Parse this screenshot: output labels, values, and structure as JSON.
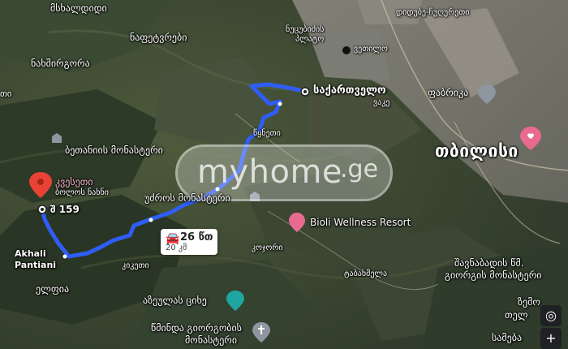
{
  "labels": {
    "mskhaldidi": "მსხალდიდი",
    "naftebi": "ნაფეტვრები",
    "nabshi": "ნახშირგორა",
    "ti": "თი",
    "betania": "ბეთანიის მონასტერი",
    "saqartvelo": "საქართველო",
    "vake": "ვაკე",
    "fabrika": "ფაბრიკა",
    "tbilisi": "თბილისი",
    "tskneti": "წყნეთი",
    "kvesety_line1": "კვესეთი",
    "kvesety_line2": "ბოლოს ნახნი",
    "sh159": "შ 159",
    "udzros": "უძროს მონასტერი",
    "bioli": "Bioli Wellness Resort",
    "akhali1": "Akhali",
    "akhali2": "Pantiani",
    "kojori": "კოჯორი",
    "kiketi": "კიკეთი",
    "tabakhmela": "ტაბახმელა",
    "elfia": "ელფია",
    "azeulas": "აზეულას ციხე",
    "tsminda1": "წმინდა გიორგობის",
    "tsminda2": "მონასტერი",
    "shavnabada1": "შავნაბადის წმ.",
    "shavnabada2": "გიორგის მონასტერი",
    "samgeba": "სამება",
    "digomi": "დიდუბე-ჩუღურეთი",
    "nutsubidze1": "ნუცუბიძის",
    "nutsubidze2": "პლატო",
    "ukhili": "ვეთილო",
    "bottom_right1": "ზემო",
    "bottom_right2": "თელ"
  },
  "route": {
    "time": "26 წთ",
    "distance": "20 კმ"
  },
  "watermark": {
    "main": "myhome",
    "ge": ".ge"
  },
  "controls": {
    "locate": "◎",
    "zoom_in": "+"
  },
  "colors": {
    "route": "#2f5df5",
    "pin": "#e94235",
    "city_pin": "#e86a8f",
    "poi": "#8e96a0"
  }
}
